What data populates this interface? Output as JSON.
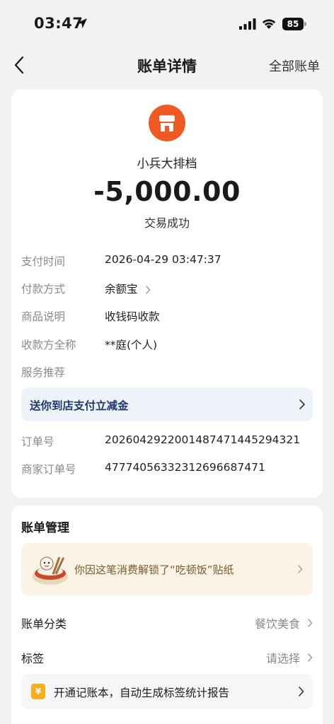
{
  "status_bar": {
    "time": "03:47",
    "battery": "85"
  },
  "nav": {
    "title": "账单详情",
    "right_link": "全部账单"
  },
  "merchant": {
    "name": "小兵大排档",
    "amount": "-5,000.00",
    "status": "交易成功"
  },
  "details": [
    {
      "label": "支付时间",
      "value": "2026-04-29 03:47:37"
    },
    {
      "label": "付款方式",
      "value": "余额宝"
    },
    {
      "label": "商品说明",
      "value": "收钱码收款"
    },
    {
      "label": "收款方全称",
      "value": "**庭(个人)"
    },
    {
      "label": "服务推荐",
      "value": ""
    }
  ],
  "promo": {
    "text": "送你到店支付立减金"
  },
  "orders": [
    {
      "label": "订单号",
      "value": "2026042922001487471445294321"
    },
    {
      "label": "商家订单号",
      "value": "4777405633231269668747​1"
    }
  ],
  "management": {
    "title": "账单管理",
    "sticker_text": "你因这笔消费解锁了“吃顿饭”贴纸",
    "category_label": "账单分类",
    "category_value": "餐饮美食",
    "tag_label": "标签",
    "tag_value": "请选择",
    "ledger_icon": "¥",
    "ledger_text": "开通记账本，自动生成标签统计报告"
  },
  "colors": {
    "brand_orange": "#f05a22",
    "promo_blue": "#1c3a70",
    "sticker_bg": "#fbf4e6"
  }
}
